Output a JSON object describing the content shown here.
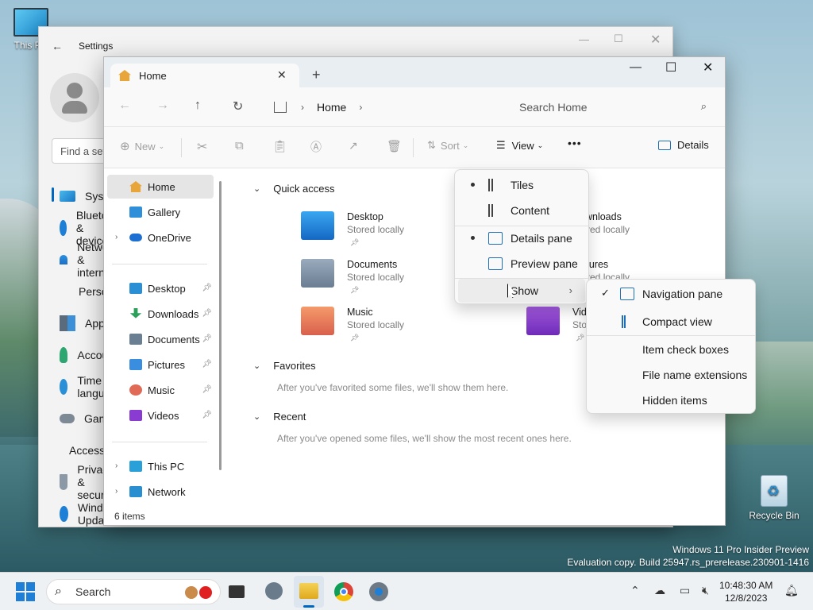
{
  "desktop": {
    "icons": [
      {
        "label": "This PC"
      },
      {
        "label": "Recycle Bin"
      }
    ],
    "watermark": {
      "line1": "Windows 11 Pro Insider Preview",
      "line2": "Evaluation copy. Build 25947.rs_prerelease.230901-1416"
    }
  },
  "settings": {
    "title": "Settings",
    "find_placeholder": "Find a setting",
    "nav": [
      {
        "label": "System",
        "icon": "monitor-icon"
      },
      {
        "label": "Bluetooth & devices",
        "icon": "bluetooth-icon"
      },
      {
        "label": "Network & internet",
        "icon": "wifi-icon"
      },
      {
        "label": "Personalization",
        "icon": "brush-icon"
      },
      {
        "label": "Apps",
        "icon": "apps-icon"
      },
      {
        "label": "Accounts",
        "icon": "person-icon"
      },
      {
        "label": "Time & language",
        "icon": "globe-clock-icon"
      },
      {
        "label": "Gaming",
        "icon": "gamepad-icon"
      },
      {
        "label": "Accessibility",
        "icon": "accessibility-icon"
      },
      {
        "label": "Privacy & security",
        "icon": "shield-icon"
      },
      {
        "label": "Windows Update",
        "icon": "update-icon"
      }
    ]
  },
  "explorer": {
    "tab_title": "Home",
    "breadcrumb": "Home",
    "search_placeholder": "Search Home",
    "toolbar": {
      "new": "New",
      "sort": "Sort",
      "view": "View",
      "more": "•••",
      "details": "Details"
    },
    "sidebar": {
      "top": [
        {
          "label": "Home",
          "color": "#e8a53a"
        },
        {
          "label": "Gallery",
          "color": "#2f8fd8"
        },
        {
          "label": "OneDrive",
          "color": "#1d6fd1"
        }
      ],
      "pinned": [
        {
          "label": "Desktop",
          "color": "#2b8fd6"
        },
        {
          "label": "Downloads",
          "color": "#2aa05a"
        },
        {
          "label": "Documents",
          "color": "#6b7f92"
        },
        {
          "label": "Pictures",
          "color": "#3a8ee0"
        },
        {
          "label": "Music",
          "color": "#e06a55"
        },
        {
          "label": "Videos",
          "color": "#8a3bd1"
        }
      ],
      "bottom": [
        {
          "label": "This PC",
          "color": "#2aa0d8"
        },
        {
          "label": "Network",
          "color": "#2a8fd0"
        }
      ]
    },
    "quick_access": {
      "title": "Quick access",
      "items": [
        {
          "name": "Desktop",
          "sub": "Stored locally",
          "color": "#1e88d8"
        },
        {
          "name": "Documents",
          "sub": "Stored locally",
          "color": "#7d8fa3"
        },
        {
          "name": "Music",
          "sub": "Stored locally",
          "color": "#e67a60"
        },
        {
          "name": "Downloads",
          "sub": "Stored locally",
          "color": "#2aa05a"
        },
        {
          "name": "Pictures",
          "sub": "Stored locally",
          "color": "#3a8ee0"
        },
        {
          "name": "Videos",
          "sub": "Stored locally",
          "color": "#8a3bd1"
        }
      ]
    },
    "favorites": {
      "title": "Favorites",
      "message": "After you've favorited some files, we'll show them here."
    },
    "recent": {
      "title": "Recent",
      "message": "After you've opened some files, we'll show the most recent ones here."
    },
    "status": "6 items"
  },
  "view_menu": {
    "items": [
      {
        "label": "Tiles",
        "checked": true
      },
      {
        "label": "Content",
        "checked": false
      },
      {
        "label": "Details pane",
        "checked": true
      },
      {
        "label": "Preview pane",
        "checked": false
      },
      {
        "label": "Show"
      }
    ]
  },
  "show_submenu": {
    "items": [
      {
        "label": "Navigation pane",
        "checked": true
      },
      {
        "label": "Compact view",
        "checked": false
      },
      {
        "label": "Item check boxes",
        "checked": false
      },
      {
        "label": "File name extensions",
        "checked": false
      },
      {
        "label": "Hidden items",
        "checked": false
      }
    ]
  },
  "taskbar": {
    "search": "Search",
    "time": "10:48:30 AM",
    "date": "12/8/2023"
  },
  "colors": {
    "accent": "#0067c0"
  }
}
